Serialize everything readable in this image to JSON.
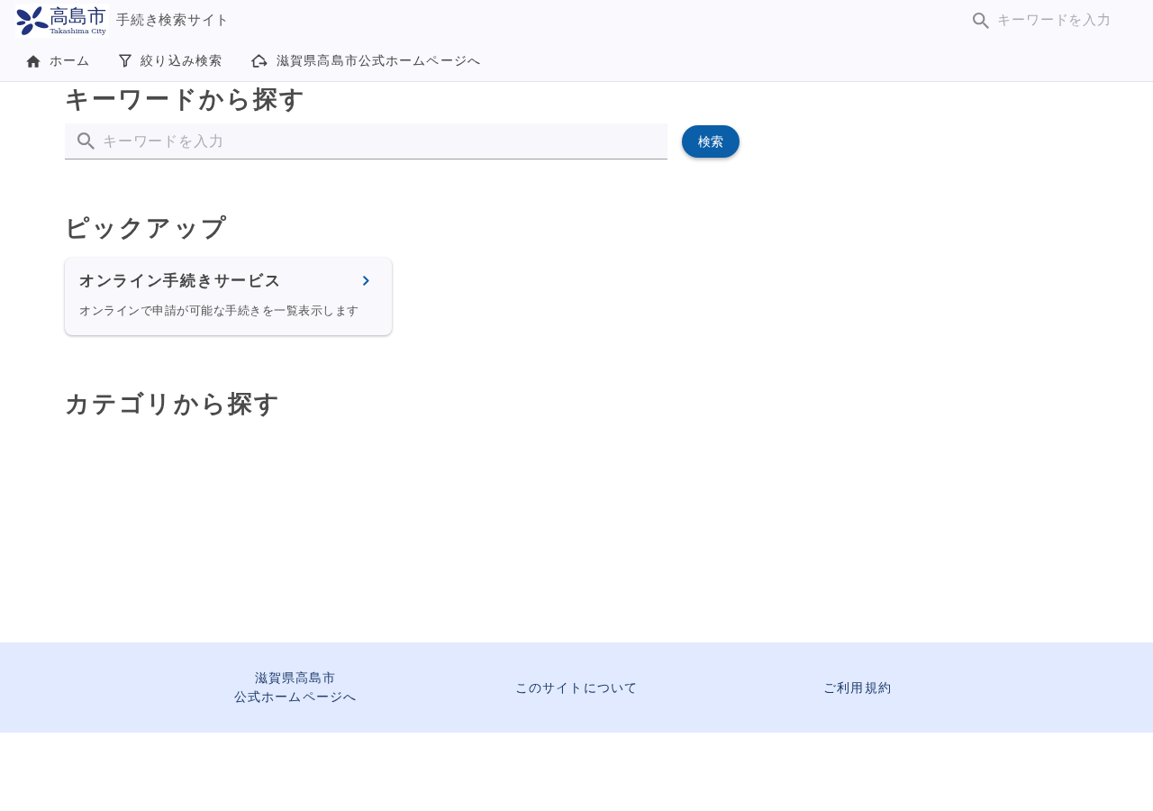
{
  "header": {
    "logo": {
      "name": "高島市",
      "subtitle": "Takashima City"
    },
    "site_title": "手続き検索サイト",
    "search": {
      "placeholder": "キーワードを入力"
    }
  },
  "nav": [
    {
      "label": "ホーム",
      "kind": "home"
    },
    {
      "label": "絞り込み検索",
      "kind": "filter"
    },
    {
      "label": "滋賀県高島市公式ホームページへ",
      "kind": "external"
    }
  ],
  "keyword_section": {
    "heading": "キーワードから探す",
    "search": {
      "placeholder": "キーワードを入力"
    },
    "button": "検索"
  },
  "pickup": {
    "heading": "ピックアップ",
    "cards": [
      {
        "title": "オンライン手続きサービス",
        "description": "オンラインで申請が可能な手続きを一覧表示します"
      }
    ]
  },
  "category": {
    "heading": "カテゴリから探す"
  },
  "footer": {
    "links": [
      {
        "lines": [
          "滋賀県高島市",
          "公式ホームページへ"
        ]
      },
      {
        "lines": [
          "このサイトについて"
        ]
      },
      {
        "lines": [
          "ご利用規約"
        ]
      }
    ]
  }
}
